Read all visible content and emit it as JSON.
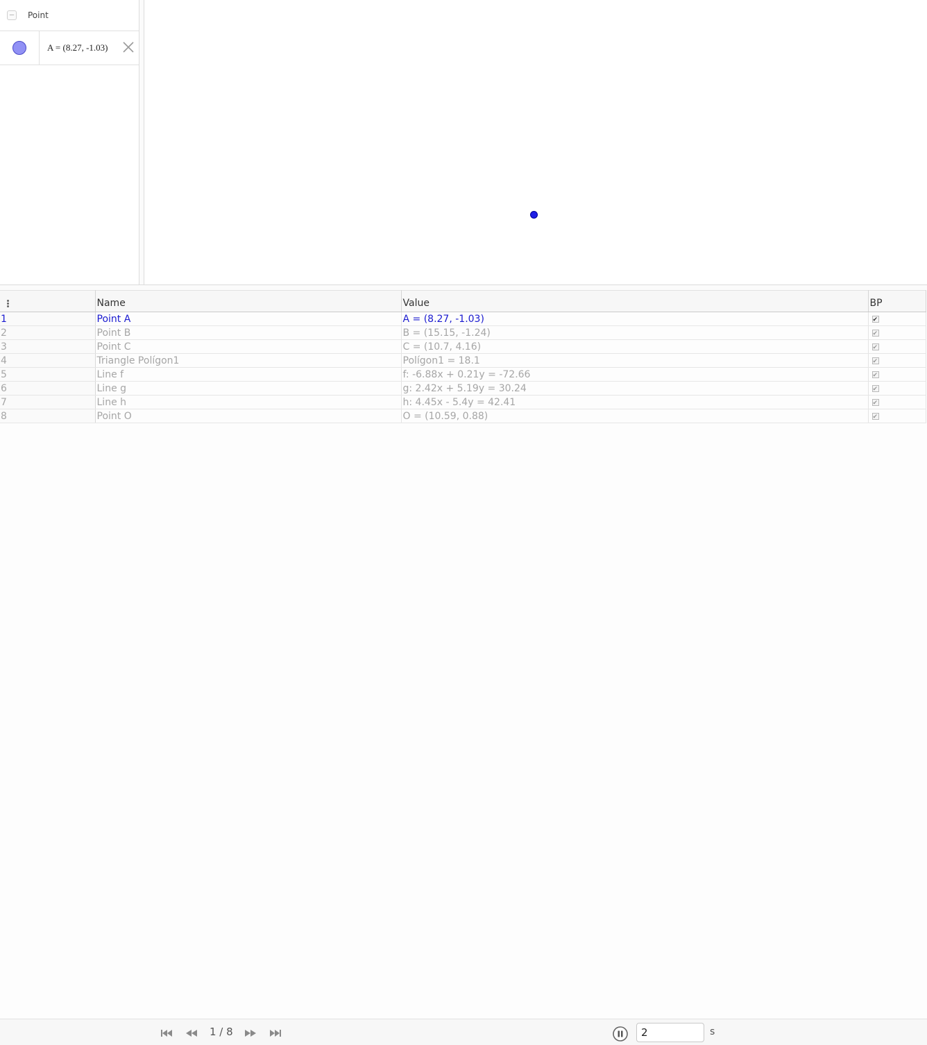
{
  "algebra": {
    "group_label": "Point",
    "items": [
      {
        "value": "A = (8.27, -1.03)",
        "color": "#9191f5"
      }
    ]
  },
  "graphics": {
    "points": [
      {
        "name": "A",
        "color": "#1f1fe6"
      }
    ]
  },
  "protocol": {
    "columns": [
      "Name",
      "Value",
      "BP"
    ],
    "rows": [
      {
        "no": "1",
        "name": "Point A",
        "value": "A = (8.27, -1.03)",
        "bp": true,
        "active": true
      },
      {
        "no": "2",
        "name": "Point B",
        "value": "B = (15.15, -1.24)",
        "bp": true,
        "active": false
      },
      {
        "no": "3",
        "name": "Point C",
        "value": "C = (10.7, 4.16)",
        "bp": true,
        "active": false
      },
      {
        "no": "4",
        "name": "Triangle Polígon1",
        "value": "Polígon1 = 18.1",
        "bp": true,
        "active": false
      },
      {
        "no": "5",
        "name": "Line f",
        "value": "f: -6.88x + 0.21y = -72.66",
        "bp": true,
        "active": false
      },
      {
        "no": "6",
        "name": "Line g",
        "value": "g: 2.42x + 5.19y = 30.24",
        "bp": true,
        "active": false
      },
      {
        "no": "7",
        "name": "Line h",
        "value": "h: 4.45x - 5.4y = 42.41",
        "bp": true,
        "active": false
      },
      {
        "no": "8",
        "name": "Point O",
        "value": "O = (10.59, 0.88)",
        "bp": true,
        "active": false
      }
    ]
  },
  "navbar": {
    "counter": "1 / 8",
    "speed_value": "2",
    "speed_unit": "s"
  }
}
